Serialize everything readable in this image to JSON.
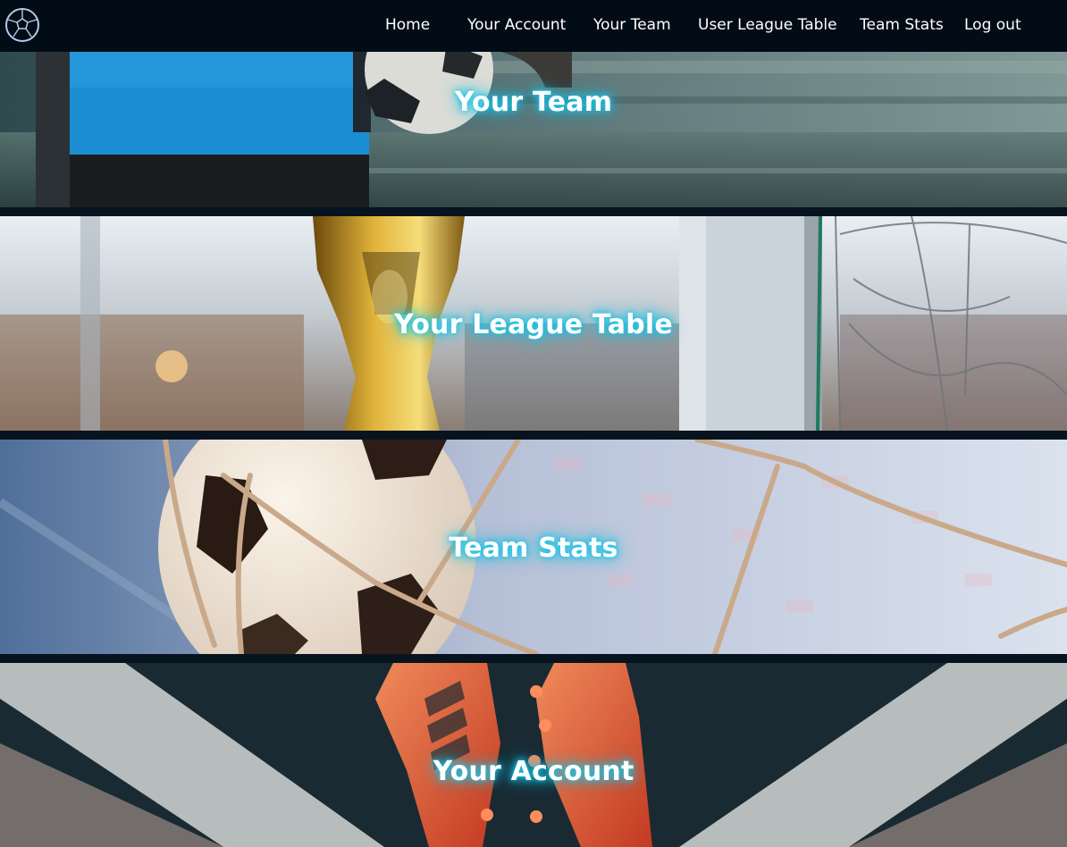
{
  "colors": {
    "navbar_bg": "#020c16",
    "page_bg": "#07141f",
    "title_glow": "#17c3e6",
    "text": "#ffffff"
  },
  "navbar": {
    "logo_icon": "soccer-ball-icon",
    "links": [
      {
        "label": "Home"
      },
      {
        "label": "Your Account"
      },
      {
        "label": "Your Team"
      },
      {
        "label": "User League Table"
      },
      {
        "label": "Team Stats"
      },
      {
        "label": "Log out"
      }
    ]
  },
  "panels": [
    {
      "title": "Your Team",
      "image": "goalkeeper-holding-ball-image"
    },
    {
      "title": "Your League Table",
      "image": "trophy-and-goalpost-image"
    },
    {
      "title": "Team Stats",
      "image": "ball-in-net-image"
    },
    {
      "title": "Your Account",
      "image": "football-boots-on-pitch-image"
    }
  ]
}
